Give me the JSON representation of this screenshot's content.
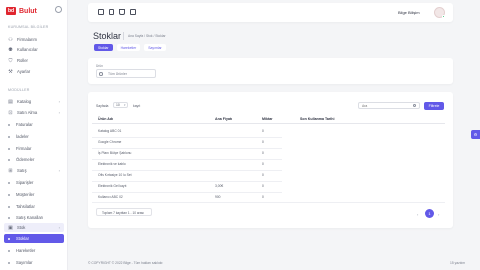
{
  "app": {
    "brand_logo": "bd",
    "brand_name": "Bulut"
  },
  "sidebar": {
    "section1": "KURUMSAL BİLGİLER",
    "items1": [
      "Firmalarım",
      "Kullanıcılar",
      "Roller",
      "Ayarlar"
    ],
    "section2": "MODÜLLER",
    "items2": [
      {
        "label": "Katalog",
        "chevron": "›"
      },
      {
        "label": "Satın Alma",
        "chevron": "›"
      },
      {
        "label": "Faturalar"
      },
      {
        "label": "İadeler"
      },
      {
        "label": "Firmalar"
      },
      {
        "label": "Ödemeler"
      },
      {
        "label": "Satış",
        "chevron": "›"
      },
      {
        "label": "Siparişler"
      },
      {
        "label": "Müşteriler"
      },
      {
        "label": "Tahsilatlar"
      },
      {
        "label": "Satış Kanalları"
      },
      {
        "label": "Stok",
        "chevron": "›"
      },
      {
        "label": "Stoklar"
      },
      {
        "label": "Hareketler"
      },
      {
        "label": "Sayımlar"
      }
    ]
  },
  "topbar": {
    "user_name": "Bilge Bilişim"
  },
  "page": {
    "title": "Stoklar",
    "breadcrumb": "Ana Sayfa  /  Stok  /  Stoklar",
    "tabs": [
      "Stoklar",
      "Hareketler",
      "Sayımlar"
    ]
  },
  "filter": {
    "label": "Ürün",
    "text": "Tüm Ürünler"
  },
  "table": {
    "show_label": "Sayfada",
    "page_size": "10",
    "records_label": "kayıt",
    "search_placeholder": "Ara",
    "search_button": "Filtrele",
    "columns": [
      "Ürün Adı",
      "Ana Fiyatı",
      "Miktar",
      "Son Kullanma Tarihi"
    ],
    "rows": [
      [
        "Katalog ABC 01",
        "",
        "0",
        ""
      ],
      [
        "Google Chrome",
        "",
        "0",
        ""
      ],
      [
        "İş Planı Bütçe Şablonu",
        "",
        "0",
        ""
      ],
      [
        "Elektronik ve kablo",
        "",
        "0",
        ""
      ],
      [
        "Ofis Kırtasiye 10 lu Set",
        "",
        "0",
        ""
      ],
      [
        "Elektronik Gel kayıt",
        "3,00€",
        "0",
        ""
      ],
      [
        "Kullanıcı ABC 02",
        "900",
        "0",
        ""
      ]
    ],
    "page_info": "Toplam 7 kayıttan 1 - 10 arası",
    "prev": "‹",
    "current_page": "1",
    "next": "›"
  },
  "footer": {
    "copyright": "© COPYRIGHT © 2022 Bilge - Tüm hakları saklıdır.",
    "right": "15 yazılım"
  },
  "colors": {
    "accent": "#6259e8",
    "brand": "#e0262f"
  },
  "icons": {
    "sidebar_toggle": "circle-icon",
    "topbar": [
      "monitor-icon",
      "document-icon",
      "cart-icon",
      "calendar-icon"
    ],
    "avatar": "avatar-image",
    "settings": "gear-icon"
  }
}
